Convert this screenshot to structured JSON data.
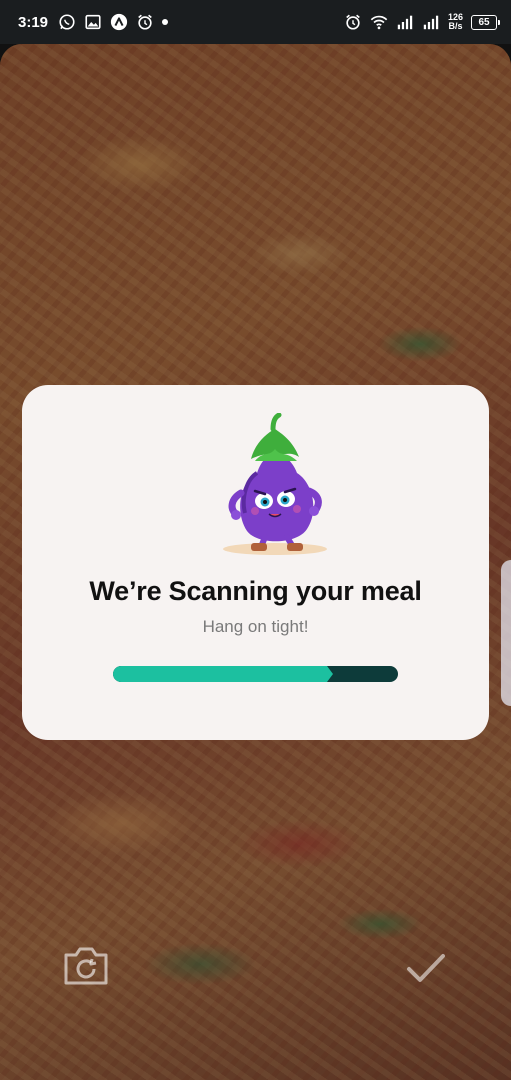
{
  "status_bar": {
    "time": "3:19",
    "net_speed_value": "126",
    "net_speed_unit": "B/s",
    "battery": "65",
    "left_icons": [
      "whatsapp-icon",
      "gallery-icon",
      "app-notification-icon",
      "alarm-icon",
      "more-notifications-dot"
    ],
    "right_icons": [
      "alarm-icon",
      "wifi-icon",
      "signal-icon",
      "signal-icon"
    ]
  },
  "modal": {
    "title": "We’re Scanning your meal",
    "subtitle": "Hang on tight!",
    "progress_percent": 75,
    "colors": {
      "progress_fill": "#1cc0a0",
      "progress_track": "#0d3b3a",
      "card_bg": "#f7f3f2"
    }
  },
  "controls": {
    "retake_icon": "camera-switch-icon",
    "confirm_icon": "checkmark-icon"
  }
}
